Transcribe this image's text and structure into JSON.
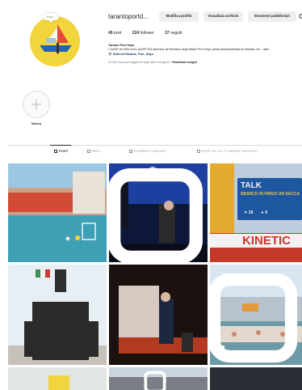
{
  "profile": {
    "username": "tarantoportd...",
    "note": "Nota...",
    "buttons": {
      "edit": "Modifica profilo",
      "archive": "Visualizza archivio",
      "tools": "Strumenti pubblicitari"
    },
    "stats": {
      "posts_value": "49",
      "posts_label": "post",
      "followers_value": "224",
      "followers_label": "follower",
      "following_value": "37",
      "following_label": "seguiti"
    },
    "bio": {
      "name": "Taranto Port Days",
      "text": "L'AdSP del Mar Ionio (AdSP MI) aderisce all'iniziativa degli Italian Port Days (www.italianportdays.it) lasciata nel... altro",
      "link": "linktr.ee/Taranto_Port_Days",
      "insight_text": "22.500 account raggiunti negli ultimi 30 giorni.",
      "insight_link": "Visualizza insight"
    }
  },
  "highlight": {
    "label": "Nuovo"
  },
  "tabs": [
    {
      "label": "POST",
      "active": true
    },
    {
      "label": "REEL",
      "active": false
    },
    {
      "label": "ELEMENTI SALVATI",
      "active": false
    },
    {
      "label": "POST IN CUI TI HANNO TAGGATO",
      "active": false
    }
  ],
  "grid": {
    "hover_likes": "16",
    "hover_comments": "0",
    "talk_title": "TALK",
    "talk_sub": "SBARCO IN FRIGO UN SACCA",
    "kinetic_text": "KINETIC"
  },
  "colors": {
    "link": "#00376b",
    "button_bg": "#efefef",
    "divider": "#dbdbdb",
    "avatar_yellow": "#f2d53c"
  }
}
